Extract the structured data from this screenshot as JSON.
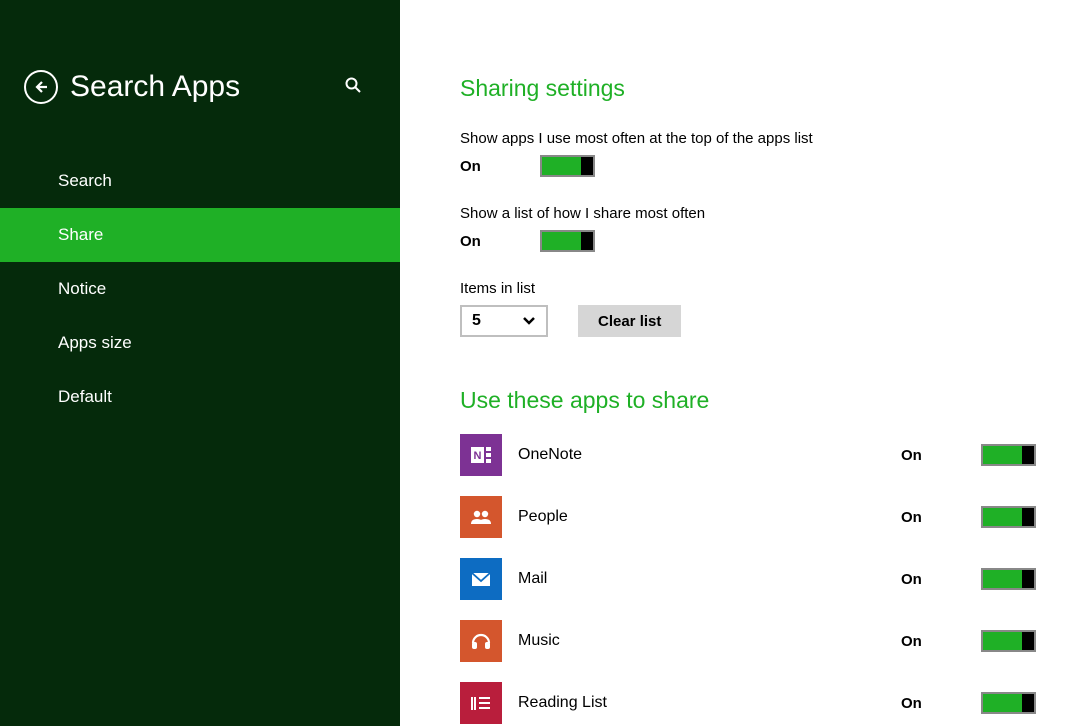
{
  "sidebar": {
    "title": "Search Apps",
    "items": [
      {
        "label": "Search",
        "active": false
      },
      {
        "label": "Share",
        "active": true
      },
      {
        "label": "Notice",
        "active": false
      },
      {
        "label": "Apps size",
        "active": false
      },
      {
        "label": "Default",
        "active": false
      }
    ]
  },
  "main": {
    "sharing_heading": "Sharing settings",
    "show_most_used": {
      "label": "Show apps I use most often at the top of the apps list",
      "state": "On"
    },
    "show_share_list": {
      "label": "Show a list of how I share most often",
      "state": "On"
    },
    "items_in_list": {
      "label": "Items in list",
      "value": "5",
      "clear_label": "Clear list"
    },
    "apps_heading": "Use these apps to share",
    "apps": [
      {
        "name": "OneNote",
        "state": "On"
      },
      {
        "name": "People",
        "state": "On"
      },
      {
        "name": "Mail",
        "state": "On"
      },
      {
        "name": "Music",
        "state": "On"
      },
      {
        "name": "Reading List",
        "state": "On"
      }
    ]
  }
}
